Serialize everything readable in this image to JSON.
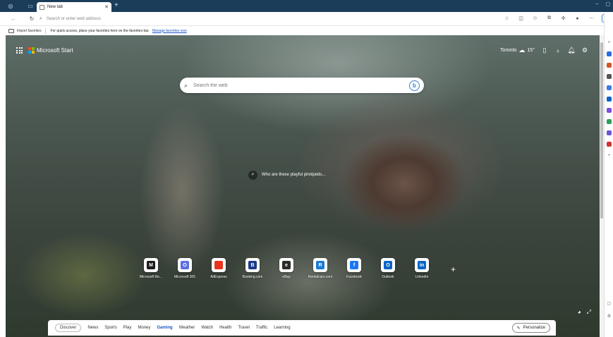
{
  "browser": {
    "tab_title": "New tab",
    "address_placeholder": "Search or enter web address"
  },
  "favorites_bar": {
    "import_label": "Import favorites",
    "hint": "For quick access, place your favorites here on the favorites bar.",
    "manage_link": "Manage favorites now"
  },
  "header": {
    "brand": "Microsoft Start",
    "city": "Toronto",
    "temperature": "15°"
  },
  "search": {
    "placeholder": "Search the web"
  },
  "image_caption": "Who are these playful pinnipeds...",
  "quick_links": [
    {
      "label": "Microsoft Re...",
      "icon": "microsoft-rewards-icon",
      "color": "#1b1b1b",
      "glyph": "M"
    },
    {
      "label": "Microsoft 365",
      "icon": "microsoft-365-icon",
      "color": "#5b6fe0",
      "glyph": "O"
    },
    {
      "label": "AliExpress",
      "icon": "aliexpress-icon",
      "color": "#e8341c",
      "glyph": ""
    },
    {
      "label": "Booking.com",
      "icon": "booking-icon",
      "color": "#1a3b8a",
      "glyph": "B"
    },
    {
      "label": "eBay",
      "icon": "ebay-icon",
      "color": "#2b2b2b",
      "glyph": "e"
    },
    {
      "label": "Rentalcars.com",
      "icon": "rentalcars-icon",
      "color": "#1a7bd6",
      "glyph": "R"
    },
    {
      "label": "Facebook",
      "icon": "facebook-icon",
      "color": "#1877f2",
      "glyph": "f"
    },
    {
      "label": "Outlook",
      "icon": "outlook-icon",
      "color": "#0a64c8",
      "glyph": "O"
    },
    {
      "label": "LinkedIn",
      "icon": "linkedin-icon",
      "color": "#0a66c2",
      "glyph": "in"
    }
  ],
  "categories": [
    "Discover",
    "News",
    "Sports",
    "Play",
    "Money",
    "Gaming",
    "Weather",
    "Watch",
    "Health",
    "Travel",
    "Traffic",
    "Learning"
  ],
  "active_category": "Gaming",
  "personalize_label": "Personalize",
  "colors": {
    "titlebar": "#1c3d5a",
    "link": "#1a55c9"
  }
}
